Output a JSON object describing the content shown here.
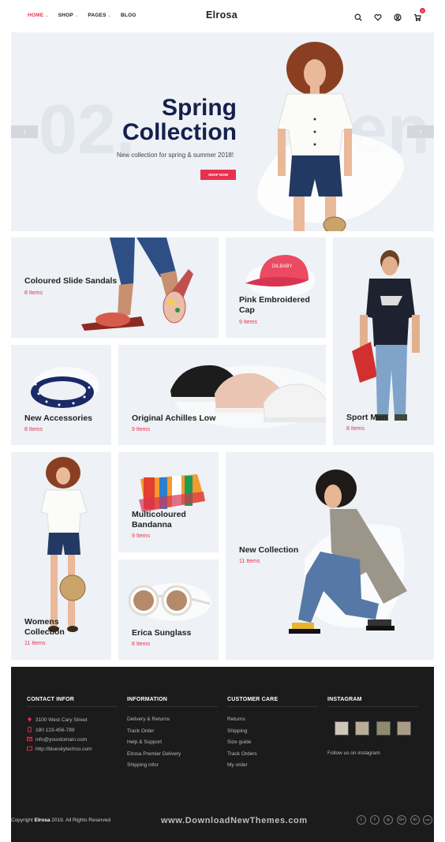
{
  "header": {
    "nav": [
      {
        "label": "HOME",
        "caret": "⌄"
      },
      {
        "label": "SHOP",
        "caret": "⌄"
      },
      {
        "label": "PAGES",
        "caret": "⌄"
      },
      {
        "label": "BLOG",
        "caret": ""
      }
    ],
    "logo": "Elrosa",
    "cart_count": "0",
    "icons": [
      "search-icon",
      "heart-icon",
      "user-icon",
      "cart-icon"
    ]
  },
  "hero": {
    "slide_number": "02.",
    "ghost_right": "en",
    "title_line1": "Spring",
    "title_line2": "Collection",
    "subtitle": "New collection for spring & summer 2018!",
    "button": "SHOP NOW",
    "prev": "‹",
    "next": "›"
  },
  "tiles": [
    {
      "title": "Coloured Slide Sandals",
      "count": "8 Items"
    },
    {
      "title": "Pink Embroidered Cap",
      "count": "9 Items"
    },
    {
      "title": "Sport Men",
      "count": "8 Items"
    },
    {
      "title": "New Accessories",
      "count": "8 Items"
    },
    {
      "title": "Original Achilles Low",
      "count": "9 Items"
    },
    {
      "title": "Womens Collection",
      "count": "11 Items"
    },
    {
      "title": "Multicoloured Bandanna",
      "count": "9 Items"
    },
    {
      "title": "Erica Sunglass",
      "count": "8 Items"
    },
    {
      "title": "New Collection",
      "count": "11 Items"
    }
  ],
  "footer": {
    "contact": {
      "heading": "CONTACT INFOR",
      "address": "3100 West Cary Street",
      "phone": "180 123-456-789",
      "email": "info@yourdomain.com",
      "web": "http://blueskytechco.com"
    },
    "information": {
      "heading": "INFORMATION",
      "links": [
        "Delivery & Returns",
        "Track Order",
        "Help & Support",
        "Elrosa Premier Delivery",
        "Shipping infor"
      ]
    },
    "care": {
      "heading": "CUSTOMER CARE",
      "links": [
        "Returns",
        "Shipping",
        "Size guide",
        "Track Orders",
        "My order"
      ]
    },
    "instagram": {
      "heading": "INSTAGRAM",
      "follow": "Follow us on instagram"
    },
    "copyright_pre": "Copyright ",
    "copyright_brand": "Elrosa",
    "copyright_post": " 2019. All Rights Reserved",
    "social": [
      "t",
      "f",
      "◎",
      "G+",
      "in",
      "rss"
    ]
  },
  "watermark": "www.DownloadNewThemes.com",
  "colors": {
    "accent": "#e8314f",
    "navy": "#14204d",
    "tile_bg": "#eef1f5",
    "footer_bg": "#1b1b1b"
  }
}
